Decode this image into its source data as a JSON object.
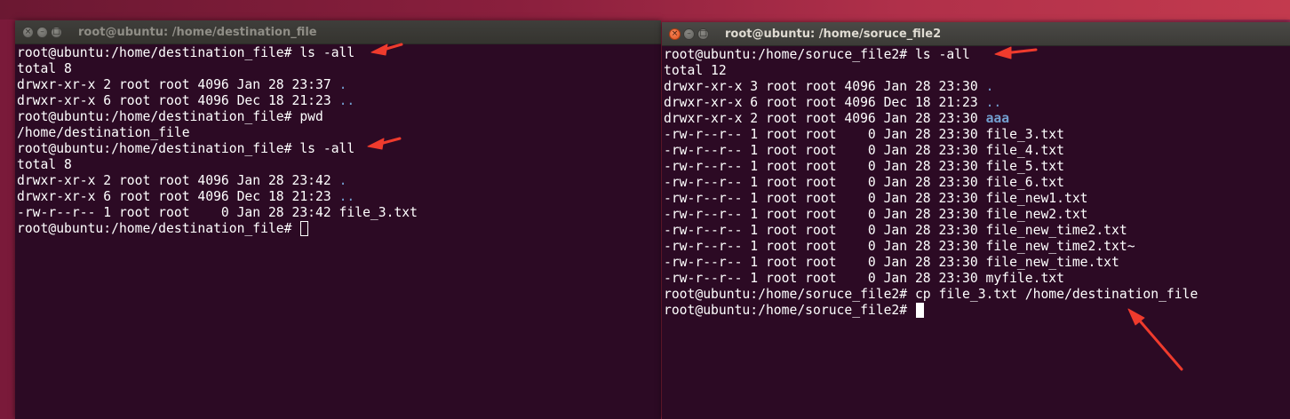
{
  "left_terminal": {
    "title": "root@ubuntu: /home/destination_file",
    "lines": [
      [
        {
          "t": "root@ubuntu:/home/destination_file# ls -all"
        }
      ],
      [
        {
          "t": "total 8"
        }
      ],
      [
        {
          "t": "drwxr-xr-x 2 root root 4096 Jan 28 23:37 "
        },
        {
          "t": ".",
          "c": "dir"
        }
      ],
      [
        {
          "t": "drwxr-xr-x 6 root root 4096 Dec 18 21:23 "
        },
        {
          "t": "..",
          "c": "dir"
        }
      ],
      [
        {
          "t": "root@ubuntu:/home/destination_file# pwd"
        }
      ],
      [
        {
          "t": "/home/destination_file"
        }
      ],
      [
        {
          "t": "root@ubuntu:/home/destination_file# ls -all"
        }
      ],
      [
        {
          "t": "total 8"
        }
      ],
      [
        {
          "t": "drwxr-xr-x 2 root root 4096 Jan 28 23:42 "
        },
        {
          "t": ".",
          "c": "dir"
        }
      ],
      [
        {
          "t": "drwxr-xr-x 6 root root 4096 Dec 18 21:23 "
        },
        {
          "t": "..",
          "c": "dir"
        }
      ],
      [
        {
          "t": "-rw-r--r-- 1 root root    0 Jan 28 23:42 file_3.txt"
        }
      ],
      [
        {
          "t": "root@ubuntu:/home/destination_file# "
        },
        {
          "cursor": "hollow"
        }
      ]
    ]
  },
  "right_terminal": {
    "title": "root@ubuntu: /home/soruce_file2",
    "lines": [
      [
        {
          "t": "root@ubuntu:/home/soruce_file2# ls -all"
        }
      ],
      [
        {
          "t": "total 12"
        }
      ],
      [
        {
          "t": "drwxr-xr-x 3 root root 4096 Jan 28 23:30 "
        },
        {
          "t": ".",
          "c": "dir"
        }
      ],
      [
        {
          "t": "drwxr-xr-x 6 root root 4096 Dec 18 21:23 "
        },
        {
          "t": "..",
          "c": "dir"
        }
      ],
      [
        {
          "t": "drwxr-xr-x 2 root root 4096 Jan 28 23:30 "
        },
        {
          "t": "aaa",
          "c": "dir-bold"
        }
      ],
      [
        {
          "t": "-rw-r--r-- 1 root root    0 Jan 28 23:30 file_3.txt"
        }
      ],
      [
        {
          "t": "-rw-r--r-- 1 root root    0 Jan 28 23:30 file_4.txt"
        }
      ],
      [
        {
          "t": "-rw-r--r-- 1 root root    0 Jan 28 23:30 file_5.txt"
        }
      ],
      [
        {
          "t": "-rw-r--r-- 1 root root    0 Jan 28 23:30 file_6.txt"
        }
      ],
      [
        {
          "t": "-rw-r--r-- 1 root root    0 Jan 28 23:30 file_new1.txt"
        }
      ],
      [
        {
          "t": "-rw-r--r-- 1 root root    0 Jan 28 23:30 file_new2.txt"
        }
      ],
      [
        {
          "t": "-rw-r--r-- 1 root root    0 Jan 28 23:30 file_new_time2.txt"
        }
      ],
      [
        {
          "t": "-rw-r--r-- 1 root root    0 Jan 28 23:30 file_new_time2.txt~"
        }
      ],
      [
        {
          "t": "-rw-r--r-- 1 root root    0 Jan 28 23:30 file_new_time.txt"
        }
      ],
      [
        {
          "t": "-rw-r--r-- 1 root root    0 Jan 28 23:30 myfile.txt"
        }
      ],
      [
        {
          "t": "root@ubuntu:/home/soruce_file2# cp file_3.txt /home/destination_file"
        }
      ],
      [
        {
          "t": "root@ubuntu:/home/soruce_file2# "
        },
        {
          "cursor": "solid"
        }
      ]
    ]
  },
  "window_controls": {
    "close": "×",
    "minimize": "–",
    "maximize": "□"
  },
  "colors": {
    "terminal_bg": "#2c0a24",
    "text": "#ffffff",
    "directory": "#729fcf",
    "annotation_arrow": "#ef3b2d",
    "close_button": "#e0531f"
  }
}
